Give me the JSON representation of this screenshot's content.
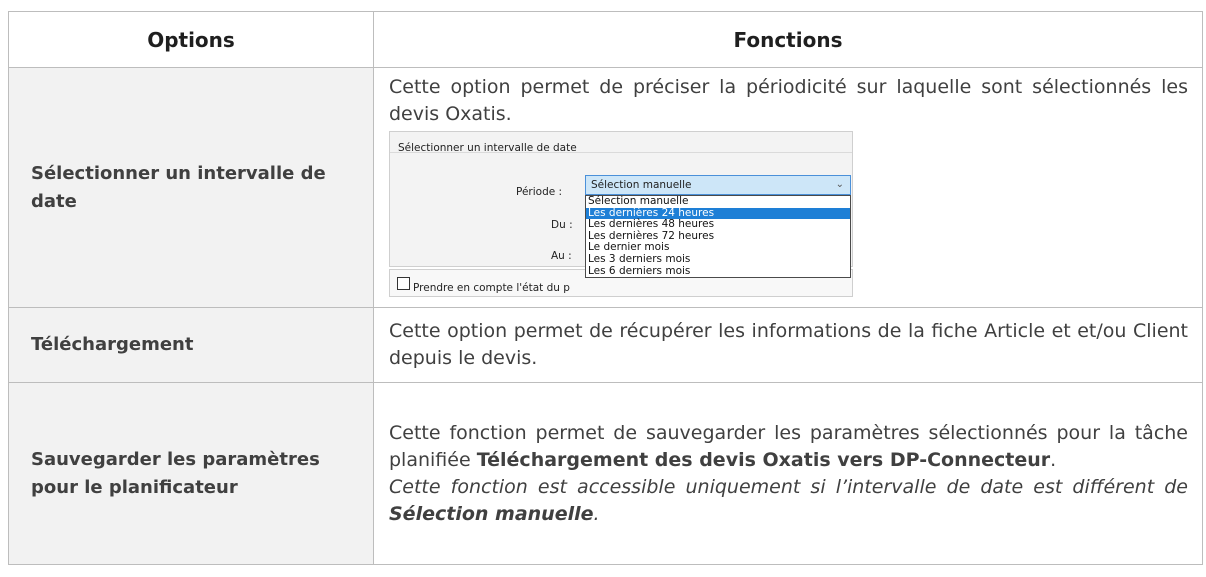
{
  "table": {
    "headers": [
      "Options",
      "Fonctions"
    ],
    "rows": [
      {
        "option": "Sélectionner un intervalle de date",
        "description": "Cette option permet de préciser la périodicité sur laquelle sont sélectionnés les devis Oxatis."
      },
      {
        "option": "Téléchargement",
        "description": "Cette option permet de récupérer les informations de la fiche Article et et/ou Client depuis le devis."
      },
      {
        "option": "Sauvegarder les paramètres pour le planificateur",
        "description_part1": "Cette fonction permet de sauvegarder les paramètres sélectionnés pour la tâche planifiée ",
        "description_bold": "Téléchargement des devis Oxatis vers DP-Connecteur",
        "description_part2": ".",
        "note_part1": "Cette fonction est accessible uniquement si l’intervalle de date est différent de ",
        "note_bold": "Sélection manuelle",
        "note_part2": "."
      }
    ]
  },
  "dialog": {
    "group_title_accel": "S",
    "group_title_rest": "électionner un intervalle de date",
    "periode_label": "Période :",
    "du_label": "Du :",
    "au_label": "Au :",
    "combo_value": "Sélection manuelle",
    "combo_arrow_icon": "chevron-down-icon",
    "dropdown_options": [
      "Sélection manuelle",
      "Les dernières 24 heures",
      "Les dernières 48 heures",
      "Les dernières 72 heures",
      "Le dernier mois",
      "Les 3 derniers mois",
      "Les 6 derniers mois"
    ],
    "selected_index": 1,
    "checkbox_label": "Prendre en compte l'état du p"
  },
  "colors": {
    "header_bg": "#ffffff",
    "option_bg": "#f2f2f2",
    "border": "#bdbdbd",
    "dropdown_selected": "#1e7fd6",
    "combo_bg": "#cde6f8"
  }
}
